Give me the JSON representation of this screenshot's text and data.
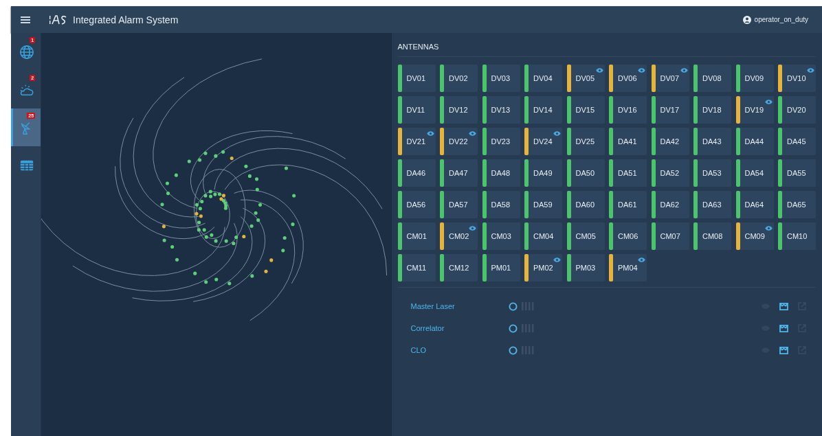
{
  "header": {
    "title": "Integrated Alarm System",
    "user": "operator_on_duty"
  },
  "sidebar": {
    "items": [
      {
        "kind": "globe",
        "badge": "1",
        "selected": false
      },
      {
        "kind": "weather",
        "badge": "2",
        "selected": false
      },
      {
        "kind": "antenna",
        "badge": "25",
        "selected": true
      },
      {
        "kind": "table",
        "selected": false
      }
    ]
  },
  "antennas": {
    "title": "ANTENNAS",
    "items": [
      {
        "name": "DV01",
        "color": "#4cc46c",
        "eye": false
      },
      {
        "name": "DV02",
        "color": "#4cc46c",
        "eye": false
      },
      {
        "name": "DV03",
        "color": "#4cc46c",
        "eye": false
      },
      {
        "name": "DV04",
        "color": "#4cc46c",
        "eye": false
      },
      {
        "name": "DV05",
        "color": "#e6b43c",
        "eye": true
      },
      {
        "name": "DV06",
        "color": "#e6b43c",
        "eye": true
      },
      {
        "name": "DV07",
        "color": "#e6b43c",
        "eye": true
      },
      {
        "name": "DV08",
        "color": "#4cc46c",
        "eye": false
      },
      {
        "name": "DV09",
        "color": "#4cc46c",
        "eye": false
      },
      {
        "name": "DV10",
        "color": "#e6b43c",
        "eye": true
      },
      {
        "name": "DV11",
        "color": "#4cc46c",
        "eye": false
      },
      {
        "name": "DV12",
        "color": "#4cc46c",
        "eye": false
      },
      {
        "name": "DV13",
        "color": "#4cc46c",
        "eye": false
      },
      {
        "name": "DV14",
        "color": "#4cc46c",
        "eye": false
      },
      {
        "name": "DV15",
        "color": "#4cc46c",
        "eye": false
      },
      {
        "name": "DV16",
        "color": "#4cc46c",
        "eye": false
      },
      {
        "name": "DV17",
        "color": "#4cc46c",
        "eye": false
      },
      {
        "name": "DV18",
        "color": "#4cc46c",
        "eye": false
      },
      {
        "name": "DV19",
        "color": "#e6b43c",
        "eye": true
      },
      {
        "name": "DV20",
        "color": "#4cc46c",
        "eye": false
      },
      {
        "name": "DV21",
        "color": "#e6b43c",
        "eye": true
      },
      {
        "name": "DV22",
        "color": "#e6b43c",
        "eye": true
      },
      {
        "name": "DV23",
        "color": "#4cc46c",
        "eye": false
      },
      {
        "name": "DV24",
        "color": "#e6b43c",
        "eye": true
      },
      {
        "name": "DV25",
        "color": "#4cc46c",
        "eye": false
      },
      {
        "name": "DA41",
        "color": "#4cc46c",
        "eye": false
      },
      {
        "name": "DA42",
        "color": "#4cc46c",
        "eye": false
      },
      {
        "name": "DA43",
        "color": "#4cc46c",
        "eye": false
      },
      {
        "name": "DA44",
        "color": "#4cc46c",
        "eye": false
      },
      {
        "name": "DA45",
        "color": "#4cc46c",
        "eye": false
      },
      {
        "name": "DA46",
        "color": "#4cc46c",
        "eye": false
      },
      {
        "name": "DA47",
        "color": "#4cc46c",
        "eye": false
      },
      {
        "name": "DA48",
        "color": "#4cc46c",
        "eye": false
      },
      {
        "name": "DA49",
        "color": "#4cc46c",
        "eye": false
      },
      {
        "name": "DA50",
        "color": "#4cc46c",
        "eye": false
      },
      {
        "name": "DA51",
        "color": "#4cc46c",
        "eye": false
      },
      {
        "name": "DA52",
        "color": "#4cc46c",
        "eye": false
      },
      {
        "name": "DA53",
        "color": "#4cc46c",
        "eye": false
      },
      {
        "name": "DA54",
        "color": "#4cc46c",
        "eye": false
      },
      {
        "name": "DA55",
        "color": "#4cc46c",
        "eye": false
      },
      {
        "name": "DA56",
        "color": "#4cc46c",
        "eye": false
      },
      {
        "name": "DA57",
        "color": "#4cc46c",
        "eye": false
      },
      {
        "name": "DA58",
        "color": "#4cc46c",
        "eye": false
      },
      {
        "name": "DA59",
        "color": "#4cc46c",
        "eye": false
      },
      {
        "name": "DA60",
        "color": "#4cc46c",
        "eye": false
      },
      {
        "name": "DA61",
        "color": "#4cc46c",
        "eye": false
      },
      {
        "name": "DA62",
        "color": "#4cc46c",
        "eye": false
      },
      {
        "name": "DA63",
        "color": "#4cc46c",
        "eye": false
      },
      {
        "name": "DA64",
        "color": "#4cc46c",
        "eye": false
      },
      {
        "name": "DA65",
        "color": "#4cc46c",
        "eye": false
      },
      {
        "name": "CM01",
        "color": "#4cc46c",
        "eye": false
      },
      {
        "name": "CM02",
        "color": "#e6b43c",
        "eye": true
      },
      {
        "name": "CM03",
        "color": "#4cc46c",
        "eye": false
      },
      {
        "name": "CM04",
        "color": "#4cc46c",
        "eye": false
      },
      {
        "name": "CM05",
        "color": "#4cc46c",
        "eye": false
      },
      {
        "name": "CM06",
        "color": "#4cc46c",
        "eye": false
      },
      {
        "name": "CM07",
        "color": "#4cc46c",
        "eye": false
      },
      {
        "name": "CM08",
        "color": "#4cc46c",
        "eye": false
      },
      {
        "name": "CM09",
        "color": "#e6b43c",
        "eye": true
      },
      {
        "name": "CM10",
        "color": "#4cc46c",
        "eye": false
      },
      {
        "name": "CM11",
        "color": "#4cc46c",
        "eye": false
      },
      {
        "name": "CM12",
        "color": "#4cc46c",
        "eye": false
      },
      {
        "name": "PM01",
        "color": "#4cc46c",
        "eye": false
      },
      {
        "name": "PM02",
        "color": "#e6b43c",
        "eye": true
      },
      {
        "name": "PM03",
        "color": "#4cc46c",
        "eye": false
      },
      {
        "name": "PM04",
        "color": "#e6b43c",
        "eye": true
      }
    ]
  },
  "devices": [
    {
      "name": "Master Laser"
    },
    {
      "name": "Correlator"
    },
    {
      "name": "CLO"
    }
  ]
}
